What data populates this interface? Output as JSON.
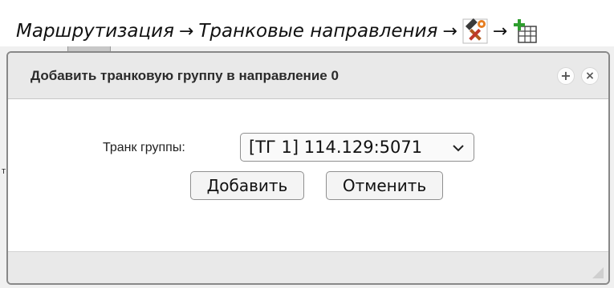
{
  "breadcrumb": {
    "item1": "Маршрутизация",
    "item2": "Транковые направления",
    "separator": "→",
    "icon1": "tools-icon",
    "icon2": "add-table-icon"
  },
  "background": {
    "mark": "т"
  },
  "dialog": {
    "title": "Добавить транковую группу в направление 0",
    "field_label": "Транк группы:",
    "select_value": "[ТГ 1] 114.129:5071",
    "add_button": "Добавить",
    "cancel_button": "Отменить",
    "header_plus": "+",
    "header_close": "×"
  }
}
